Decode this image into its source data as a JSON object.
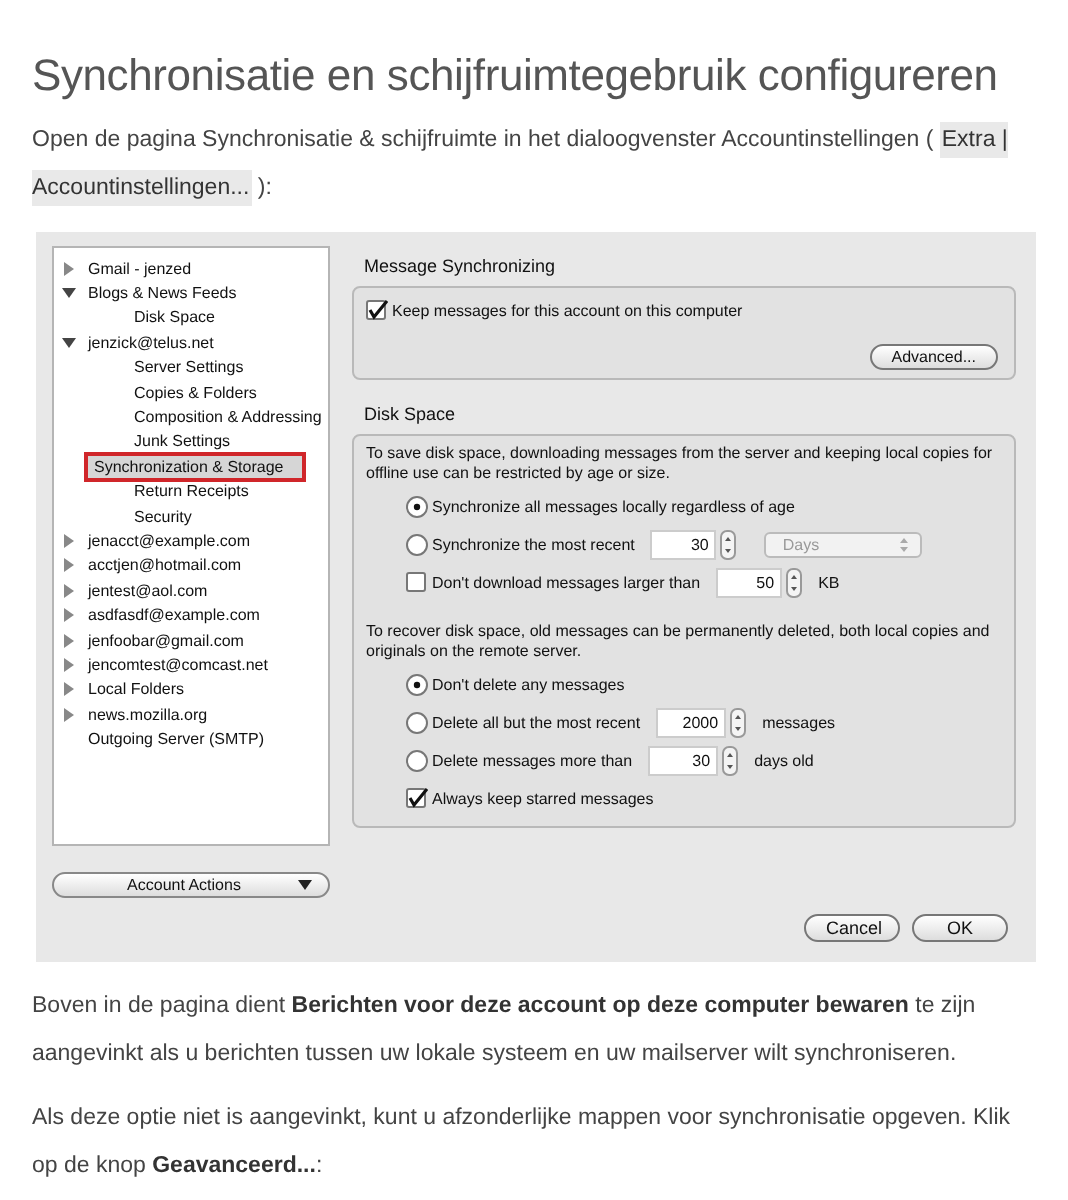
{
  "title": "Synchronisatie en schijfruimtegebruik configureren",
  "intro": [
    {
      "kind": "text",
      "text": "Open de pagina Synchronisatie & schijfruimte in het dialoogvenster Accountinstellingen ( "
    },
    {
      "kind": "menu",
      "text": "Extra | Accountinstellingen..."
    },
    {
      "kind": "text",
      "text": " ):"
    }
  ],
  "dialog": {
    "sidebar": {
      "items": [
        {
          "label": "Gmail - jenzed",
          "kind": "expandable",
          "expanded": false,
          "selected": false
        },
        {
          "label": "Blogs & News Feeds",
          "kind": "expandable",
          "expanded": true,
          "selected": false,
          "children": [
            {
              "label": "Disk Space",
              "selected": false
            }
          ]
        },
        {
          "label": "jenzick@telus.net",
          "kind": "expandable",
          "expanded": true,
          "selected": false,
          "children": [
            {
              "label": "Server Settings",
              "selected": false
            },
            {
              "label": "Copies & Folders",
              "selected": false
            },
            {
              "label": "Composition & Addressing",
              "selected": false
            },
            {
              "label": "Junk Settings",
              "selected": false
            },
            {
              "label": "Synchronization & Storage",
              "selected": true
            },
            {
              "label": "Return Receipts",
              "selected": false
            },
            {
              "label": "Security",
              "selected": false
            }
          ]
        },
        {
          "label": "jenacct@example.com",
          "kind": "expandable",
          "expanded": false,
          "selected": false
        },
        {
          "label": "acctjen@hotmail.com",
          "kind": "expandable",
          "expanded": false,
          "selected": false
        },
        {
          "label": "jentest@aol.com",
          "kind": "expandable",
          "expanded": false,
          "selected": false
        },
        {
          "label": "asdfasdf@example.com",
          "kind": "expandable",
          "expanded": false,
          "selected": false
        },
        {
          "label": "jenfoobar@gmail.com",
          "kind": "expandable",
          "expanded": false,
          "selected": false
        },
        {
          "label": "jencomtest@comcast.net",
          "kind": "expandable",
          "expanded": false,
          "selected": false
        },
        {
          "label": "Local Folders",
          "kind": "expandable",
          "expanded": false,
          "selected": false
        },
        {
          "label": "news.mozilla.org",
          "kind": "expandable",
          "expanded": false,
          "selected": false
        },
        {
          "label": "Outgoing Server (SMTP)",
          "kind": "plain",
          "selected": false
        }
      ]
    },
    "account_actions": "Account Actions",
    "message_sync": {
      "title": "Message Synchronizing",
      "keep_messages": {
        "label": "Keep messages for this account on this computer",
        "checked": true
      },
      "advanced_button": "Advanced..."
    },
    "disk_space": {
      "title": "Disk Space",
      "intro": "To save disk space, downloading messages from the server and keeping local copies for offline use can be restricted by age or size.",
      "sync_options": [
        {
          "label": "Synchronize all messages locally regardless of age",
          "selected": true
        },
        {
          "label": "Synchronize the most recent",
          "selected": false,
          "value": "30",
          "dropdown": {
            "value": "Days",
            "disabled": true
          }
        }
      ],
      "size_limit": {
        "label": "Don't download messages larger than",
        "checked": false,
        "value": "50",
        "unit": "KB"
      },
      "delete_intro": "To recover disk space, old messages can be permanently deleted, both local copies and originals on the remote server.",
      "delete_options": [
        {
          "label": "Don't delete any messages",
          "selected": true
        },
        {
          "label": "Delete all but the most recent",
          "selected": false,
          "value": "2000",
          "unit": "messages"
        },
        {
          "label": "Delete messages more than",
          "selected": false,
          "value": "30",
          "unit": "days old"
        }
      ],
      "keep_starred": {
        "label": "Always keep starred messages",
        "checked": true
      }
    },
    "buttons": [
      {
        "label": "Cancel"
      },
      {
        "label": "OK"
      }
    ]
  },
  "paragraphs": [
    "Boven in de pagina dient **Berichten voor deze account op deze computer bewaren** te zijn aangevinkt als u berichten tussen uw lokale systeem en uw mailserver wilt synchroniseren.",
    "Als deze optie niet is aangevinkt, kunt u afzonderlijke mappen voor synchronisatie opgeven. Klik op de knop **Geavanceerd...**:"
  ]
}
